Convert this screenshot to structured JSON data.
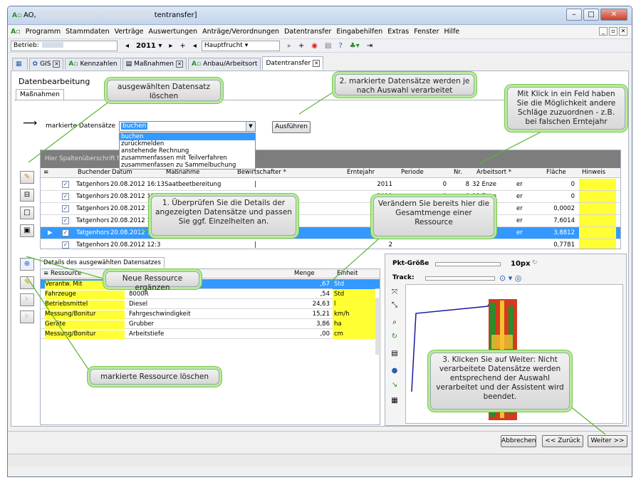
{
  "window": {
    "app_icon": "A▫",
    "title_prefix": "AO,",
    "title_suffix": "tentransfer]",
    "controls": [
      "–",
      "□",
      "✕"
    ]
  },
  "menu": [
    "Programm",
    "Stammdaten",
    "Verträge",
    "Auswertungen",
    "Anträge/Verordnungen",
    "Datentransfer",
    "Eingabehilfen",
    "Extras",
    "Fenster",
    "Hilfe"
  ],
  "toolbar": {
    "betrieb_label": "Betrieb:",
    "year": "2011",
    "fruit": "Hauptfrucht"
  },
  "tabs": [
    {
      "label": "GIS",
      "icon": "gis-icon"
    },
    {
      "label": "Kennzahlen",
      "icon": "app-icon"
    },
    {
      "label": "Maßnahmen",
      "icon": "document-icon"
    },
    {
      "label": "Anbau/Arbeitsort",
      "icon": "app-icon"
    },
    {
      "label": "Datentransfer",
      "icon": ""
    }
  ],
  "section": {
    "title": "Datenbearbeitung",
    "subtab": "Maßnahmen",
    "mark_label": "markierte Datensätze",
    "combo_value": "buchen",
    "options": [
      "buchen",
      "zurückmelden",
      "anstehende Rechnung",
      "zusammenfassen mit Teilverfahren",
      "zusammenfassen zu Sammelbuchung"
    ],
    "execute_label": "Ausführen"
  },
  "grid": {
    "hint": "Hier Spaltenüberschrift für Gruppierung hierher ziehen",
    "headers": [
      "Buchender",
      "Datum",
      "Maßnahme",
      "Bewirtschafter *",
      "Erntejahr",
      "Periode",
      "Nr.",
      "Arbeitsort *",
      "Fläche",
      "Hinweis"
    ],
    "rows": [
      {
        "who": "Tatgenhors",
        "date": "20.08.2012 16:13",
        "action": "Saatbeetbereitung",
        "year": "2011",
        "period": "0",
        "nr": "8",
        "place": "32 Enze",
        "place2": "er",
        "area": "0"
      },
      {
        "who": "Tatgenhors",
        "date": "20.08.2012 15:41",
        "action": "Saatbeetbereitung",
        "year": "2011",
        "period": "0",
        "nr": "8",
        "place": "32 Enze",
        "place2": "er",
        "area": "0"
      },
      {
        "who": "Tatgenhors",
        "date": "20.08.2012 15:2",
        "action": "",
        "year": "",
        "period": "",
        "nr": "",
        "place": "",
        "place2": "er",
        "area": "0,0002"
      },
      {
        "who": "Tatgenhors",
        "date": "20.08.2012 13:4",
        "action": "",
        "year": "",
        "period": "",
        "nr": "",
        "place": "",
        "place2": "er",
        "area": "7,6014"
      },
      {
        "who": "Tatgenhors",
        "date": "20.08.2012 13",
        "action": "",
        "year": "2",
        "period": "",
        "nr": "",
        "place": "",
        "place2": "er",
        "area": "3,8812"
      },
      {
        "who": "Tatgenhors",
        "date": "20.08.2012 12:3",
        "action": "",
        "year": "2",
        "period": "",
        "nr": "",
        "place": "",
        "place2": "",
        "area": "0,7781"
      }
    ]
  },
  "detail": {
    "tab": "Details des ausgewählten Datensatzes",
    "headers": [
      "Ressource",
      "Menge",
      "Einheit"
    ],
    "rows": [
      {
        "type": "Verantw. Mit",
        "name": "",
        "amount": ",67",
        "unit": "Std"
      },
      {
        "type": "Fahrzeuge",
        "name": "8000R",
        "amount": ",54",
        "unit": "Std"
      },
      {
        "type": "Betriebsmittel",
        "name": "Diesel",
        "amount": "24,63",
        "unit": "l"
      },
      {
        "type": "Messung/Bonitur",
        "name": "Fahrgeschwindigkeit",
        "amount": "15,21",
        "unit": "km/h"
      },
      {
        "type": "Geräte",
        "name": "Grubber",
        "amount": "3,86",
        "unit": "ha"
      },
      {
        "type": "Messung/Bonitur",
        "name": "Arbeitstiefe",
        "amount": ",00",
        "unit": "cm"
      }
    ]
  },
  "map": {
    "pkt_label": "Pkt-Größe",
    "pkt_value": "10px",
    "track_label": "Track:"
  },
  "callouts": {
    "delete_record": "ausgewählten Datensatz löschen",
    "process": "2. markierte Datensätze werden je nach Auswahl verarbeitet",
    "click_field": "Mit Klick in ein Feld haben Sie die Möglichkeit andere Schläge zuzuordnen - z.B. bei falschen Erntejahr",
    "check_details": "1. Überprüfen Sie die Details der angezeigten Datensätze und passen Sie ggf. Einzelheiten an.",
    "change_amount": "Verändern Sie bereits hier die Gesamtmenge einer Ressource",
    "add_resource": "Neue Ressource ergänzen",
    "delete_resource": "markierte Ressource löschen",
    "next_step": "3. Klicken Sie auf Weiter: Nicht verarbeitete Datensätze werden entsprechend der Auswahl verarbeitet und der Assistent wird beendet."
  },
  "footer": {
    "cancel": "Abbrechen",
    "back": "<< Zurück",
    "next": "Weiter >>"
  },
  "colors": {
    "highlight": "#3399ff",
    "yellow": "#ffff33",
    "callout_border": "#79c64d"
  }
}
